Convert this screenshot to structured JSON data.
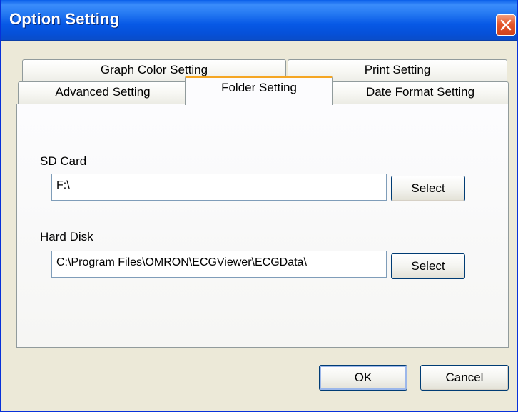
{
  "window": {
    "title": "Option Setting"
  },
  "tabs": {
    "back_row": [
      {
        "label": "Graph Color Setting"
      },
      {
        "label": "Print Setting"
      }
    ],
    "front_row": [
      {
        "label": "Advanced Setting"
      },
      {
        "label": "Folder Setting",
        "active": true
      },
      {
        "label": "Date Format Setting"
      }
    ]
  },
  "folder_setting": {
    "sd_card": {
      "label": "SD Card",
      "value": "F:\\",
      "button_label": "Select"
    },
    "hard_disk": {
      "label": "Hard Disk",
      "value": "C:\\Program Files\\OMRON\\ECGViewer\\ECGData\\",
      "button_label": "Select"
    }
  },
  "footer": {
    "ok_label": "OK",
    "cancel_label": "Cancel"
  },
  "colors": {
    "titlebar": "#0a5fea",
    "close_button": "#e4562c",
    "active_tab_accent": "#f5a623",
    "dialog_background": "#ece9d8"
  },
  "icons": {
    "close": "close-icon"
  }
}
